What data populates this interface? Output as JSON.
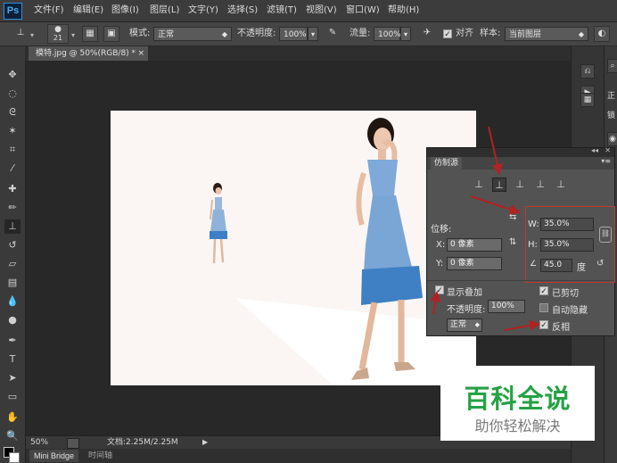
{
  "app": {
    "logo": "Ps"
  },
  "menu": [
    "文件(F)",
    "编辑(E)",
    "图像(I)",
    "图层(L)",
    "文字(Y)",
    "选择(S)",
    "滤镜(T)",
    "视图(V)",
    "窗口(W)",
    "帮助(H)"
  ],
  "options": {
    "brush_size": "21",
    "mode_label": "模式:",
    "mode_value": "正常",
    "opacity_label": "不透明度:",
    "opacity_value": "100%",
    "flow_label": "流量:",
    "flow_value": "100%",
    "aligned_label": "对齐",
    "sample_label": "样本:",
    "sample_value": "当前图层"
  },
  "document_tab": {
    "title": "模特.jpg @ 50%(RGB/8) *",
    "close": "×"
  },
  "status": {
    "zoom": "50%",
    "doc_info": "文档:2.25M/2.25M"
  },
  "bottom_tabs": [
    "Mini Bridge",
    "时间轴"
  ],
  "clone_source_panel": {
    "title": "仿制源",
    "offset_label": "位移:",
    "x_label": "X:",
    "x_value": "0 像素",
    "y_label": "Y:",
    "y_value": "0 像素",
    "w_label": "W:",
    "w_value": "35.0%",
    "h_label": "H:",
    "h_value": "35.0%",
    "angle_value": "45.0",
    "angle_unit": "度",
    "show_overlay_label": "显示叠加",
    "opacity_label": "不透明度:",
    "opacity_value": "100%",
    "clipped_label": "已剪切",
    "auto_hide_label": "自动隐藏",
    "invert_label": "反相",
    "blend_value": "正常",
    "show_overlay_checked": true,
    "clipped_checked": true,
    "auto_hide_checked": false,
    "invert_checked": true
  },
  "right_dock": {
    "side_labels": [
      "正",
      "锁"
    ]
  },
  "watermark": {
    "title": "百科全说",
    "subtitle": "助你轻松解决"
  },
  "colors": {
    "accent_red": "#c0392b",
    "canvas_bg": "#fbf6f3",
    "dress_blue": "#3f7fc4"
  }
}
